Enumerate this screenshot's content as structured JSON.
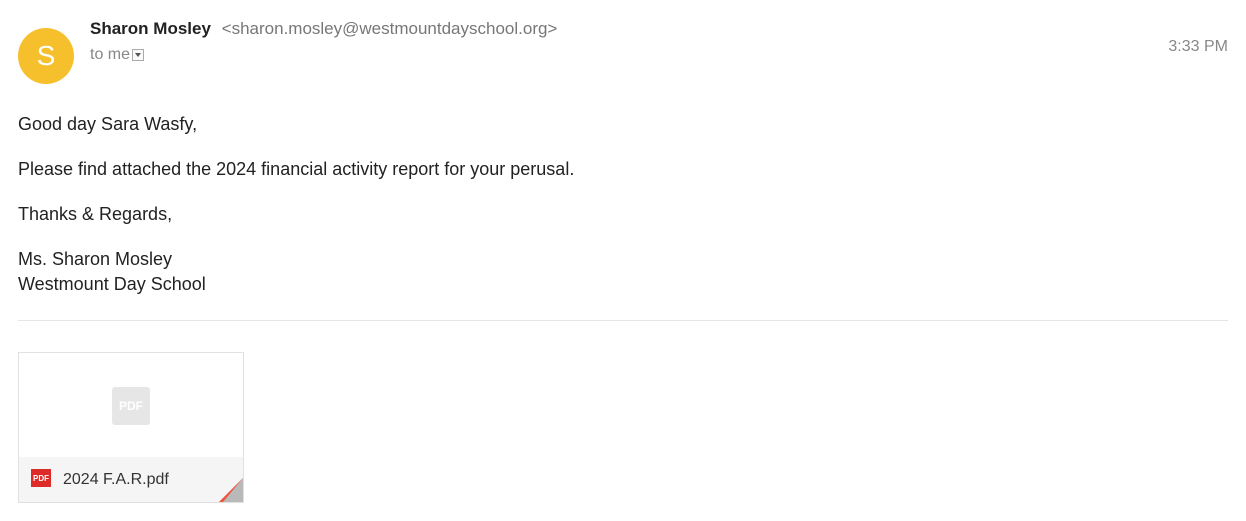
{
  "email": {
    "sender": {
      "avatar_letter": "S",
      "name": "Sharon Mosley",
      "email": "<sharon.mosley@westmountdayschool.org>"
    },
    "recipient_label": "to me",
    "time": "3:33 PM",
    "body": {
      "greeting": "Good day Sara Wasfy,",
      "paragraph": "Please find attached the 2024 financial activity report for your perusal.",
      "closing": "Thanks & Regards,",
      "signature_name": "Ms. Sharon Mosley",
      "signature_org": "Westmount Day School"
    }
  },
  "attachment": {
    "filename": "2024 F.A.R.pdf",
    "placeholder_label": "PDF",
    "icon_label": "PDF"
  },
  "colors": {
    "avatar_bg": "#f6c02c",
    "pdf_red": "#dd2c27",
    "corner_orange": "#f1523a",
    "corner_gray": "#b9b9b9"
  }
}
